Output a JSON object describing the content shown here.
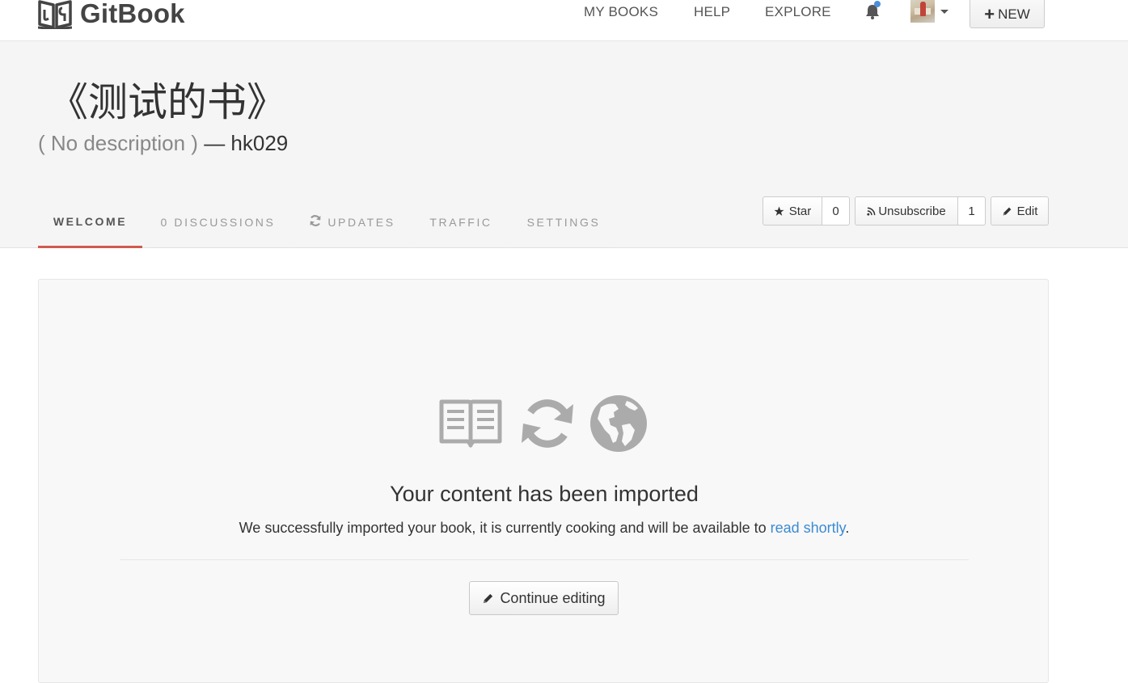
{
  "topnav": {
    "brand": "GitBook",
    "links": [
      "MY BOOKS",
      "HELP",
      "EXPLORE"
    ],
    "new_label": "NEW"
  },
  "header": {
    "title": "《测试的书》",
    "description": "( No description )",
    "separator": " — ",
    "author": "hk029",
    "tabs": [
      {
        "label": "WELCOME",
        "active": true
      },
      {
        "label": "0 DISCUSSIONS"
      },
      {
        "label": "UPDATES",
        "icon": "refresh-icon"
      },
      {
        "label": "TRAFFIC"
      },
      {
        "label": "SETTINGS"
      }
    ],
    "actions": {
      "star_label": "Star",
      "star_count": "0",
      "unsubscribe_label": "Unsubscribe",
      "subscriber_count": "1",
      "edit_label": "Edit"
    }
  },
  "panel": {
    "icons": [
      "book-icon",
      "refresh-icon",
      "globe-icon"
    ],
    "title": "Your content has been imported",
    "text_before": "We successfully imported your book, it is currently cooking and will be available to ",
    "link_text": "read shortly",
    "text_after": ".",
    "button_label": "Continue editing"
  },
  "colors": {
    "accent_tab": "#d05b4d",
    "link": "#3b8bd2",
    "notification_dot": "#4a90d9"
  }
}
